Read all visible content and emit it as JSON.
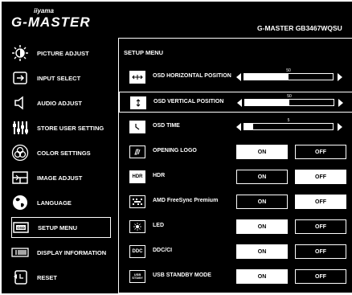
{
  "header": {
    "brand": "iiyama",
    "logo": "G-MASTER",
    "model": "G-MASTER GB3467WQSU"
  },
  "sidebar": {
    "items": [
      {
        "label": "PICTURE ADJUST",
        "icon": "brightness-icon"
      },
      {
        "label": "INPUT SELECT",
        "icon": "input-icon"
      },
      {
        "label": "AUDIO ADJUST",
        "icon": "speaker-icon"
      },
      {
        "label": "STORE USER SETTING",
        "icon": "sliders-icon"
      },
      {
        "label": "COLOR SETTINGS",
        "icon": "color-circles-icon"
      },
      {
        "label": "IMAGE ADJUST",
        "icon": "image-adjust-icon"
      },
      {
        "label": "LANGUAGE",
        "icon": "globe-icon"
      },
      {
        "label": "SETUP MENU",
        "icon": "osd-icon"
      },
      {
        "label": "DISPLAY INFORMATION",
        "icon": "info-icon"
      },
      {
        "label": "RESET",
        "icon": "reset-icon"
      }
    ],
    "active_index": 7
  },
  "panel": {
    "title": "SETUP MENU",
    "rows": [
      {
        "label": "OSD HORIZONTAL POSITION",
        "icon": "horizontal-position-icon",
        "type": "slider",
        "value": "50",
        "level": 50
      },
      {
        "label": "OSD VERTICAL POSITION",
        "icon": "vertical-position-icon",
        "type": "slider",
        "value": "50",
        "level": 50
      },
      {
        "label": "OSD TIME",
        "icon": "clock-icon",
        "type": "slider",
        "value": "5",
        "level": 10
      },
      {
        "label": "OPENING LOGO",
        "icon": "logo-icon",
        "type": "toggle",
        "on": "ON",
        "off": "OFF",
        "selected": "on"
      },
      {
        "label": "HDR",
        "icon": "hdr-icon",
        "icon_text": "HDR",
        "type": "toggle",
        "on": "ON",
        "off": "OFF",
        "selected": "off"
      },
      {
        "label": "AMD FreeSync Premium",
        "icon": "freesync-icon",
        "type": "toggle",
        "on": "ON",
        "off": "OFF",
        "selected": "off"
      },
      {
        "label": "LED",
        "icon": "led-icon",
        "type": "toggle",
        "on": "ON",
        "off": "OFF",
        "selected": "on"
      },
      {
        "label": "DDC/CI",
        "icon": "ddc-icon",
        "icon_text": "DDC",
        "type": "toggle",
        "on": "ON",
        "off": "OFF",
        "selected": "on"
      },
      {
        "label": "USB STANDBY MODE",
        "icon": "usb-standby-icon",
        "icon_text": "USB STDBY",
        "type": "toggle",
        "on": "ON",
        "off": "OFF",
        "selected": "on"
      }
    ],
    "selected_row": 1
  },
  "colors": {
    "background": "#000000",
    "foreground": "#ffffff"
  }
}
